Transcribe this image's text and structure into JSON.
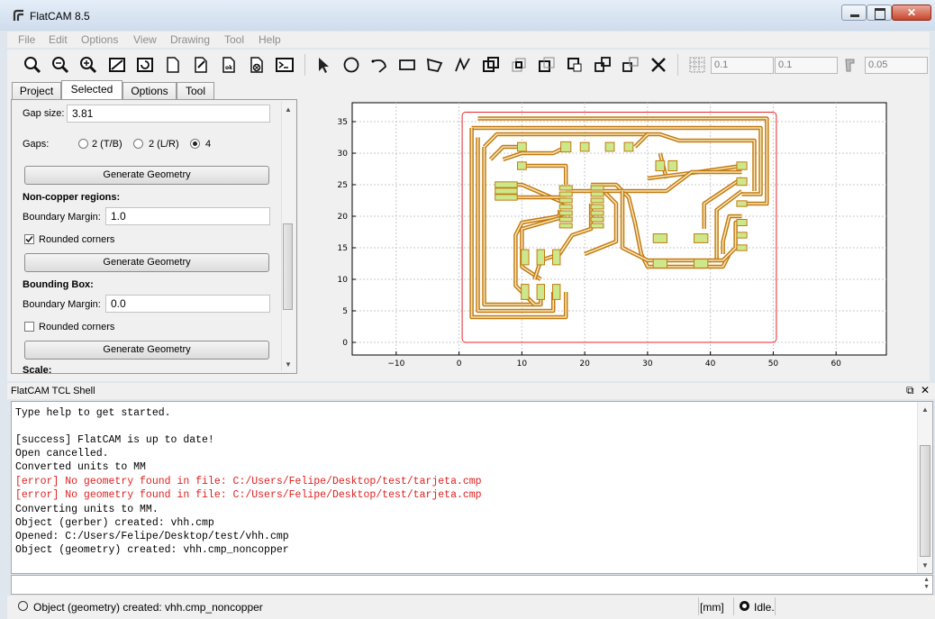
{
  "window": {
    "title": "FlatCAM 8.5",
    "minimize": "▁",
    "maximize": "□",
    "close": "✕"
  },
  "menu": [
    "File",
    "Edit",
    "Options",
    "View",
    "Drawing",
    "Tool",
    "Help"
  ],
  "toolbar": {
    "buttons": [
      "zoom-fit",
      "zoom-in",
      "zoom-out",
      "clear-plot",
      "replot",
      "new-geometry",
      "new-file",
      "open-file",
      "delete",
      "tcl-shell",
      "select",
      "circle",
      "arc",
      "rectangle",
      "polygon",
      "path",
      "union",
      "intersection",
      "subtract",
      "cut",
      "copy",
      "move",
      "edit-delete"
    ],
    "grid_x": "0.1",
    "grid_y": "0.1",
    "snap_max": "0.05"
  },
  "tabs": [
    {
      "label": "Project",
      "active": false
    },
    {
      "label": "Selected",
      "active": true
    },
    {
      "label": "Options",
      "active": false
    },
    {
      "label": "Tool",
      "active": false
    }
  ],
  "panel": {
    "gap_size_label": "Gap size:",
    "gap_size_value": "3.81",
    "gaps_label": "Gaps:",
    "gaps_options": [
      "2 (T/B)",
      "2 (L/R)",
      "4"
    ],
    "gaps_selected": "4",
    "generate_label": "Generate Geometry",
    "noncopper_title": "Non-copper regions:",
    "noncopper_margin_label": "Boundary Margin:",
    "noncopper_margin_value": "1.0",
    "noncopper_rounded_label": "Rounded corners",
    "noncopper_rounded_checked": true,
    "bbox_title": "Bounding Box:",
    "bbox_margin_label": "Boundary Margin:",
    "bbox_margin_value": "0.0",
    "bbox_rounded_label": "Rounded corners",
    "bbox_rounded_checked": false,
    "scale_title": "Scale:"
  },
  "plot": {
    "x_ticks": [
      "−10",
      "0",
      "10",
      "20",
      "30",
      "40",
      "50",
      "60"
    ],
    "y_ticks": [
      "0",
      "5",
      "10",
      "15",
      "20",
      "25",
      "30",
      "35"
    ],
    "xlim": [
      -17,
      68
    ],
    "ylim": [
      -2,
      38
    ],
    "board": {
      "x0": 0.5,
      "y0": 0,
      "x1": 50.5,
      "y1": 36.5
    },
    "colors": {
      "outline": "#e8262c",
      "trace": "#c27a10",
      "pad": "#cde88b",
      "grid": "#c8c8c8"
    }
  },
  "shell": {
    "title": "FlatCAM TCL Shell",
    "lines": [
      {
        "text": "Type help to get started.",
        "error": false
      },
      {
        "text": "",
        "error": false
      },
      {
        "text": "[success] FlatCAM is up to date!",
        "error": false
      },
      {
        "text": "Open cancelled.",
        "error": false
      },
      {
        "text": "Converted units to MM",
        "error": false
      },
      {
        "text": "[error] No geometry found in file: C:/Users/Felipe/Desktop/test/tarjeta.cmp",
        "error": true
      },
      {
        "text": "[error] No geometry found in file: C:/Users/Felipe/Desktop/test/tarjeta.cmp",
        "error": true
      },
      {
        "text": "Converting units to MM.",
        "error": false
      },
      {
        "text": "Object (gerber) created: vhh.cmp",
        "error": false
      },
      {
        "text": "Opened: C:/Users/Felipe/Desktop/test/vhh.cmp",
        "error": false
      },
      {
        "text": "Object (geometry) created: vhh.cmp_noncopper",
        "error": false
      }
    ]
  },
  "status": {
    "message": "Object (geometry) created: vhh.cmp_noncopper",
    "units": "[mm]",
    "state": "Idle."
  }
}
